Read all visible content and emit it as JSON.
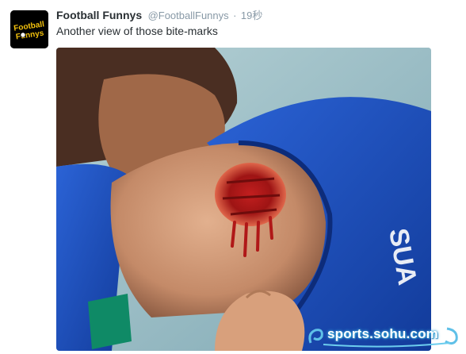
{
  "tweet": {
    "display_name": "Football Funnys",
    "handle": "@FootballFunnys",
    "separator": "·",
    "timestamp": "19秒",
    "text": "Another view of those bite-marks"
  },
  "avatar": {
    "logo_line1": "Football",
    "logo_line2": "Funnys"
  },
  "media": {
    "image_subject": "photo-shoulder-bite-marks"
  },
  "watermark": {
    "text": "sports.sohu.com"
  },
  "colors": {
    "name": "#292f33",
    "meta": "#8899a6",
    "jersey_blue": "#1f4fbf",
    "watermark_glow": "#3aa7d8"
  }
}
